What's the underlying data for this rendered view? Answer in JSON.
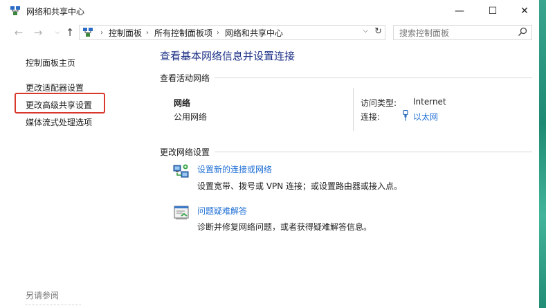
{
  "window": {
    "title": "网络和共享中心",
    "minimize_glyph": "—",
    "maximize_glyph": "☐",
    "close_glyph": "✕"
  },
  "navigation": {
    "back_glyph": "←",
    "forward_glyph": "→",
    "history_glyph": "⌵",
    "up_glyph": "↑"
  },
  "address": {
    "crumbs": [
      "控制面板",
      "所有控制面板项",
      "网络和共享中心"
    ],
    "separator": "›",
    "dropdown_glyph": "⌵",
    "refresh_glyph": "↻"
  },
  "search": {
    "placeholder": "搜索控制面板",
    "icon": "search-icon"
  },
  "left_pane": {
    "links": [
      "控制面板主页",
      "更改适配器设置",
      "更改高级共享设置",
      "媒体流式处理选项"
    ],
    "highlighted_index": 2,
    "see_also": "另请参阅"
  },
  "main": {
    "title": "查看基本网络信息并设置连接",
    "active_networks": {
      "heading": "查看活动网络",
      "network_name": "网络",
      "network_type": "公用网络",
      "access_type_label": "访问类型:",
      "access_type_value": "Internet",
      "connections_label": "连接:",
      "connection_name": "以太网"
    },
    "change_settings": {
      "heading": "更改网络设置",
      "tasks": [
        {
          "icon": "network-setup-icon",
          "link": "设置新的连接或网络",
          "description": "设置宽带、拨号或 VPN 连接；或设置路由器或接入点。"
        },
        {
          "icon": "troubleshoot-icon",
          "link": "问题疑难解答",
          "description": "诊断并修复网络问题，或者获得疑难解答信息。"
        }
      ]
    }
  },
  "colors": {
    "link": "#1f6fd4",
    "title": "#1e3287",
    "highlight": "#d9382c",
    "desktop": "#2a9a83"
  }
}
